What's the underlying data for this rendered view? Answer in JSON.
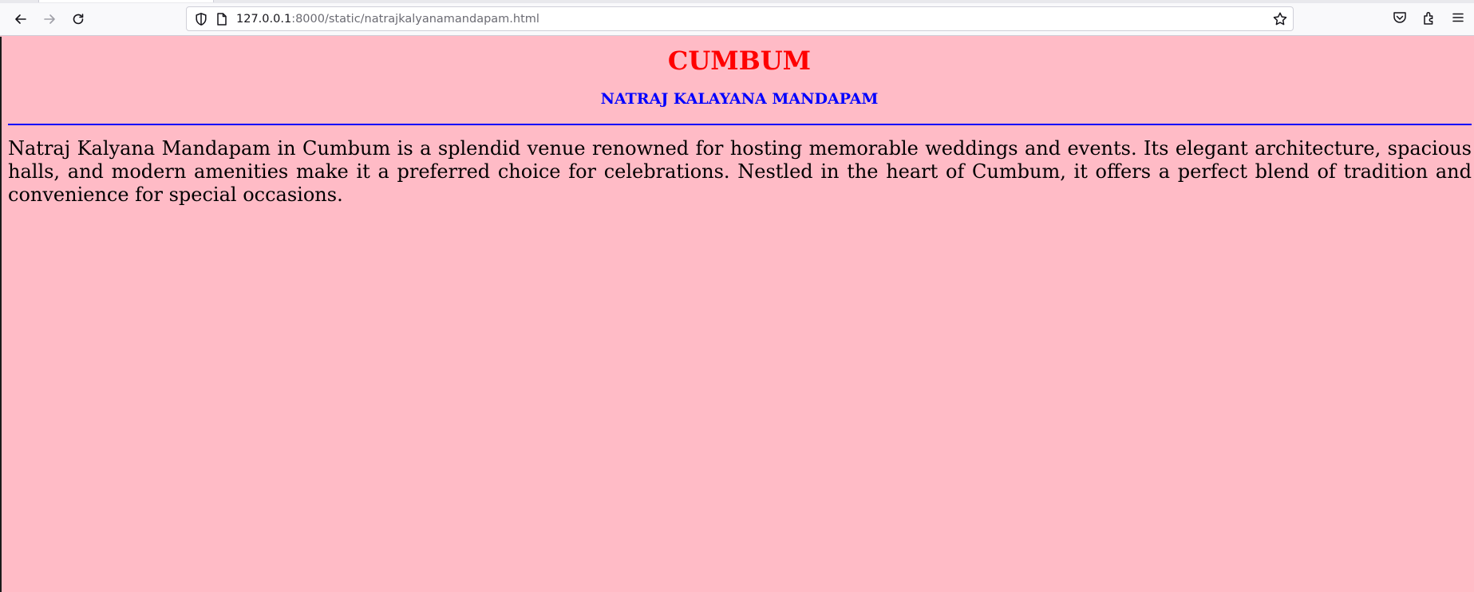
{
  "browser": {
    "url_host": "127.0.0.1",
    "url_rest": ":8000/static/natrajkalyanamandapam.html",
    "icons": {
      "back": "back-arrow-icon",
      "forward": "forward-arrow-icon",
      "reload": "reload-icon",
      "shield": "shield-icon",
      "page": "page-icon",
      "bookmark": "star-icon",
      "pocket": "pocket-icon",
      "extensions": "extensions-icon",
      "menu": "hamburger-menu-icon"
    }
  },
  "page": {
    "title": "CUMBUM",
    "subtitle": "NATRAJ KALAYANA MANDAPAM",
    "description": "Natraj Kalyana Mandapam in Cumbum is a splendid venue renowned for hosting memorable weddings and events. Its elegant architecture, spacious halls, and modern amenities make it a preferred choice for celebrations. Nestled in the heart of Cumbum, it offers a perfect blend of tradition and convenience for special occasions."
  },
  "colors": {
    "background": "#ffbbc6",
    "title": "#ff0000",
    "subtitle": "#0000ff",
    "rule": "#0000ff",
    "text": "#000000"
  }
}
